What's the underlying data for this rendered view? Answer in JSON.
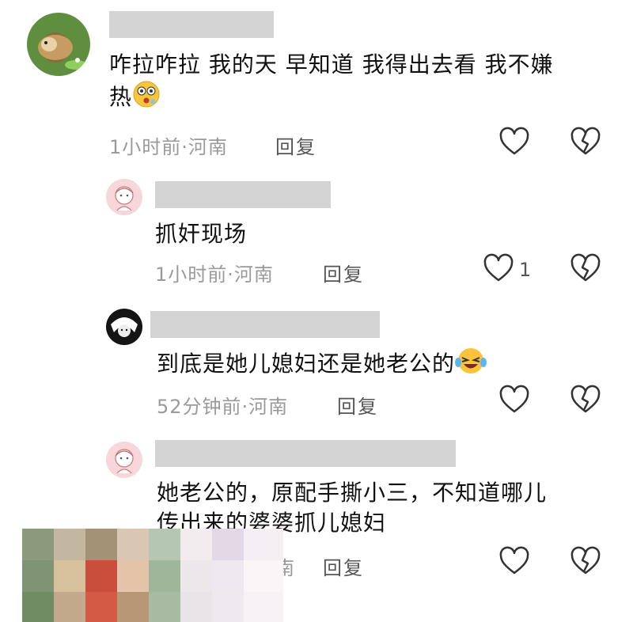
{
  "comments": [
    {
      "text_line1": "咋拉咋拉 我的天 早知道 我得出去看 我不嫌",
      "text_line2": "热",
      "emoji": "astonished-emoji",
      "meta": "1小时前·河南",
      "reply": "回复"
    },
    {
      "text": "抓奸现场",
      "meta": "1小时前·河南",
      "reply": "回复",
      "like_count": "1"
    },
    {
      "text": "到底是她儿媳妇还是她老公的",
      "emoji": "laughing-crying-emoji",
      "meta": "52分钟前·河南",
      "reply": "回复"
    },
    {
      "text_line1": "她老公的，原配手撕小三，不知道哪儿",
      "text_line2": "传出来的婆婆抓儿媳妇",
      "meta": "南",
      "reply": "回复"
    }
  ],
  "icons": {
    "like": "heart-outline-icon",
    "dislike": "broken-heart-icon"
  },
  "colors": {
    "name_placeholder": "#d4d4d4",
    "meta_text": "#9a9a9a",
    "icon_stroke": "#333333"
  }
}
